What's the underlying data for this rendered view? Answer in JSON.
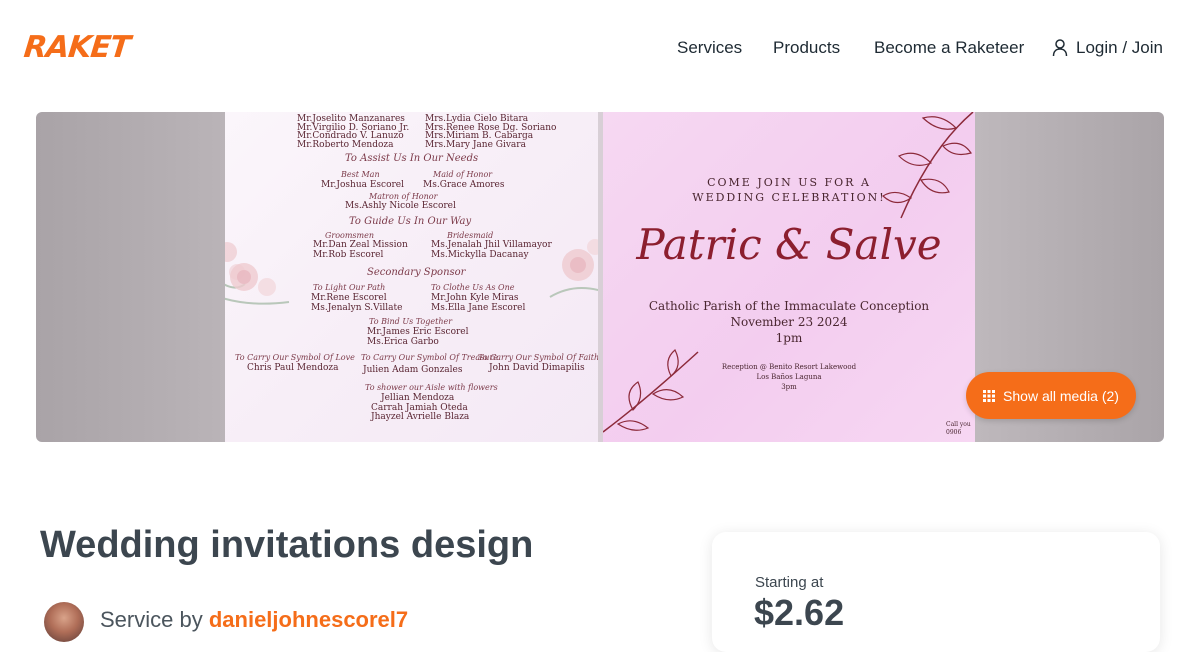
{
  "brand": {
    "logo_text": "RAKET",
    "accent": "#f56d19"
  },
  "nav": {
    "services": "Services",
    "products": "Products",
    "become": "Become a Raketeer",
    "login": "Login / Join",
    "login_icon": "user-icon"
  },
  "gallery": {
    "show_media_label": "Show all media (2)",
    "show_media_icon": "grid-icon",
    "left_image": {
      "lines": {
        "l1a": "Mr.Joselito Manzanares",
        "l1b": "Mrs.Lydia Cielo Bitara",
        "l2a": "Mr.Virgilio D. Soriano Jr.",
        "l2b": "Mrs.Renee Rose Dg. Soriano",
        "l3a": "Mr.Condrado V. Lanuzo",
        "l3b": "Mrs.Miriam B. Cabarga",
        "l4a": "Mr.Roberto Mendoza",
        "l4b": "Mrs.Mary Jane Givara",
        "h1": "To Assist Us In Our Needs",
        "s1a": "Best Man",
        "s1b": "Maid of Honor",
        "n1a": "Mr.Joshua Escorel",
        "n1b": "Ms.Grace Amores",
        "s2": "Matron of Honor",
        "n2": "Ms.Ashly Nicole Escorel",
        "h2": "To Guide Us In Our Way",
        "s3a": "Groomsmen",
        "s3b": "Bridesmaid",
        "n3a": "Mr.Dan Zeal Mission",
        "n3b": "Ms.Jenalah Jhil Villamayor",
        "n4a": "Mr.Rob Escorel",
        "n4b": "Ms.Mickylla Dacanay",
        "h3": "Secondary Sponsor",
        "s4a": "To Light Our Path",
        "s4b": "To Clothe Us As One",
        "n5a": "Mr.Rene Escorel",
        "n5b": "Mr.John Kyle Miras",
        "n6a": "Ms.Jenalyn S.Villate",
        "n6b": "Ms.Ella Jane Escorel",
        "s5": "To Bind Us Together",
        "n7": "Mr.James Eric Escorel",
        "n8": "Ms.Erica Garbo",
        "s6a": "To Carry Our Symbol Of Love",
        "s6b": "To Carry Our Symbol Of Treasure",
        "s6c": "To Carry Our Symbol Of Faith",
        "n9a": "Chris Paul Mendoza",
        "n9b": "Julien Adam Gonzales",
        "n9c": "John David Dimapilis",
        "s7": "To shower our Aisle with flowers",
        "n10": "Jellian Mendoza",
        "n11": "Carrah Jamiah Oteda",
        "n12": "Jhayzel Avrielle Blaza"
      }
    },
    "right_image": {
      "come_line1": "COME JOIN US FOR A",
      "come_line2": "WEDDING CELEBRATION!",
      "names": "Patric & Salve",
      "church": "Catholic Parish of the Immaculate Conception",
      "date": "November 23 2024",
      "time": "1pm",
      "reception1": "Reception @ Benito Resort Lakewood",
      "reception2": "Los Baños Laguna",
      "reception3": "3pm",
      "call1": "Call you",
      "call2": "0906"
    }
  },
  "service": {
    "title": "Wedding invitations design",
    "by_label": "Service by",
    "username": "danieljohnescorel7"
  },
  "pricing": {
    "starting_label": "Starting at",
    "price": "$2.62"
  }
}
